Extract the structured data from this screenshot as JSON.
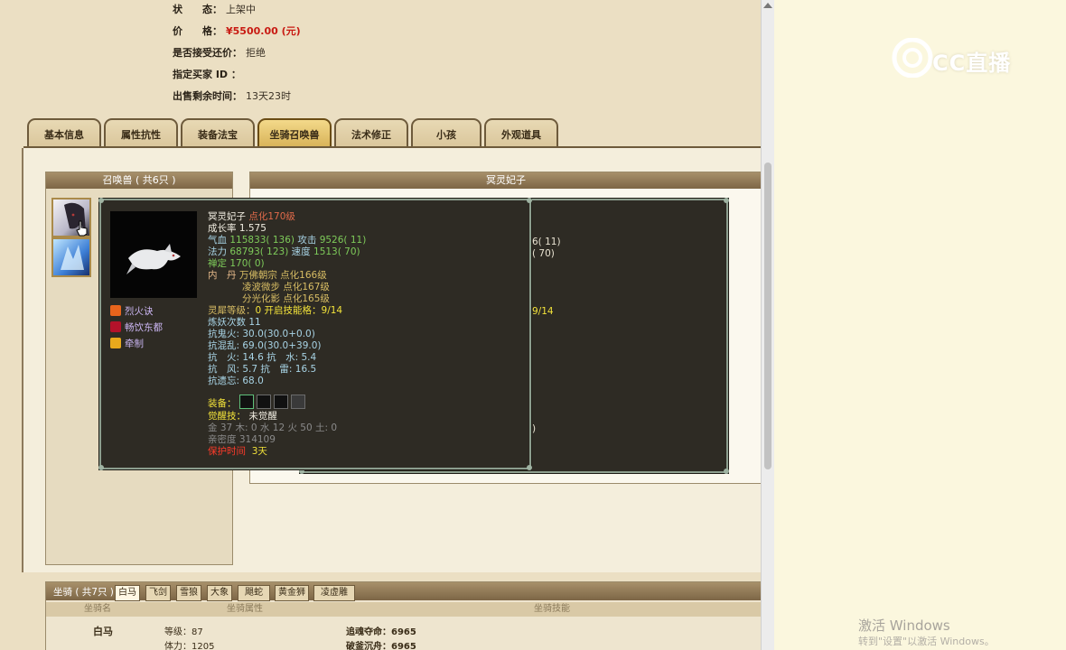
{
  "info": {
    "status_label": "状　　态：",
    "status_value": "上架中",
    "price_label": "价　　格：",
    "price_value": "¥5500.00 (元)",
    "bargain_label": "是否接受还价：",
    "bargain_value": "拒绝",
    "buyer_label": "指定买家 ID ：",
    "time_label": "出售剩余时间：",
    "time_value": "13天23时"
  },
  "tabs": [
    "基本信息",
    "属性抗性",
    "装备法宝",
    "坐骑召唤兽",
    "法术修正",
    "小孩",
    "外观道具"
  ],
  "active_tab": "坐骑召唤兽",
  "summon_panel": {
    "title": "召唤兽 ( 共6只 )"
  },
  "detail_panel": {
    "title": "冥灵妃子"
  },
  "tooltip": {
    "name": "冥灵妃子",
    "level": "点化170级",
    "growth": "成长率 1.575",
    "hp_label": "气血",
    "hp_value": "115833( 136)",
    "atk_label": "攻击",
    "atk_value": "9526( 11)",
    "mp_label": "法力",
    "mp_value": "68793( 123)",
    "spd_label": "速度",
    "spd_value": "1513( 70)",
    "zen": "禅定 170( 0)",
    "dan_label": "内　丹",
    "dan1": "万佛朝宗 点化166级",
    "dan2": "凌波微步 点化167级",
    "dan3": "分光化影 点化165级",
    "lingxi_label": "灵犀等级：",
    "lingxi_value": "0 开启技能格：9/14",
    "yao": "炼妖次数 11",
    "res1": "抗鬼火: 30.0(30.0+0.0)",
    "res2": "抗混乱: 69.0(30.0+39.0)",
    "res3": "抗　火: 14.6 抗　水: 5.4",
    "res4": "抗　风: 5.7 抗　雷: 16.5",
    "res5": "抗遗忘: 68.0",
    "equip_label": "装备：",
    "awaken_label": "觉醒技：",
    "awaken_value": "未觉醒",
    "elements": "金 37 木: 0 水 12 火 50 土: 0",
    "intimacy": "亲密度 314109",
    "protect_label": "保护时间",
    "protect_value": "3天",
    "skills": [
      "烈火诀",
      "畅饮东都",
      "牵制"
    ]
  },
  "back_tooltip": {
    "line1": "6( 11)",
    "line2": "( 70)",
    "line3": "9/14",
    "line4": ")"
  },
  "mount": {
    "title": "坐骑 ( 共7只 )",
    "tabs": [
      "白马",
      "飞剑",
      "雪狼",
      "大象",
      "飓蛇",
      "黄金狮",
      "凌虚雕"
    ],
    "headers": [
      "坐骑名",
      "坐骑属性",
      "坐骑技能"
    ],
    "row": {
      "name": "白马",
      "level": "等级：87",
      "stamina": "体力：1205",
      "skill1": "追魂夺命：6965",
      "skill2": "破釜沉舟：6965"
    }
  },
  "watermark": {
    "logo_text": "CC直播",
    "win_title": "激活 Windows",
    "win_sub": "转到\"设置\"以激活 Windows。"
  }
}
